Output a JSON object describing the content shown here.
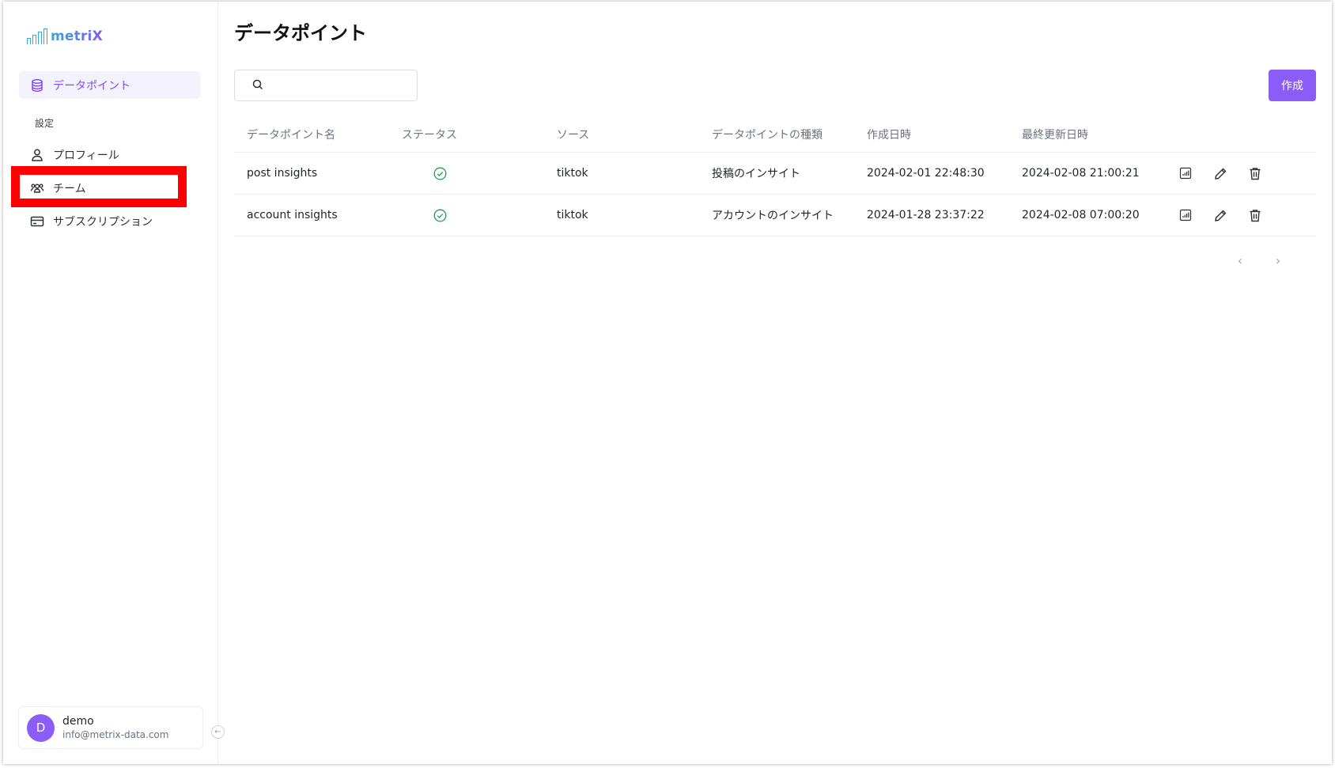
{
  "app": {
    "logo_text": "metriX"
  },
  "sidebar": {
    "primary_item": {
      "label": "データポイント",
      "icon": "database-icon"
    },
    "settings_label": "設定",
    "items": [
      {
        "label": "プロフィール",
        "icon": "user-icon"
      },
      {
        "label": "チーム",
        "icon": "team-icon"
      },
      {
        "label": "サブスクリプション",
        "icon": "credit-card-icon"
      }
    ],
    "user": {
      "initial": "D",
      "name": "demo",
      "email": "info@metrix-data.com"
    }
  },
  "main": {
    "title": "データポイント",
    "search": {
      "placeholder": "",
      "value": ""
    },
    "create_label": "作成",
    "table": {
      "headers": [
        "データポイント名",
        "ステータス",
        "ソース",
        "データポイントの種類",
        "作成日時",
        "最終更新日時"
      ],
      "rows": [
        {
          "name": "post insights",
          "status": "ok",
          "source": "tiktok",
          "type": "投稿のインサイト",
          "created": "2024-02-01 22:48:30",
          "updated": "2024-02-08 21:00:21"
        },
        {
          "name": "account insights",
          "status": "ok",
          "source": "tiktok",
          "type": "アカウントのインサイト",
          "created": "2024-01-28 23:37:22",
          "updated": "2024-02-08 07:00:20"
        }
      ]
    },
    "pagination": {
      "prev": "‹",
      "next": "›"
    }
  },
  "colors": {
    "accent": "#8b5cf6",
    "active_bg": "#f4f2fd",
    "status_ok": "#16a34a",
    "highlight": "#ff0000"
  }
}
